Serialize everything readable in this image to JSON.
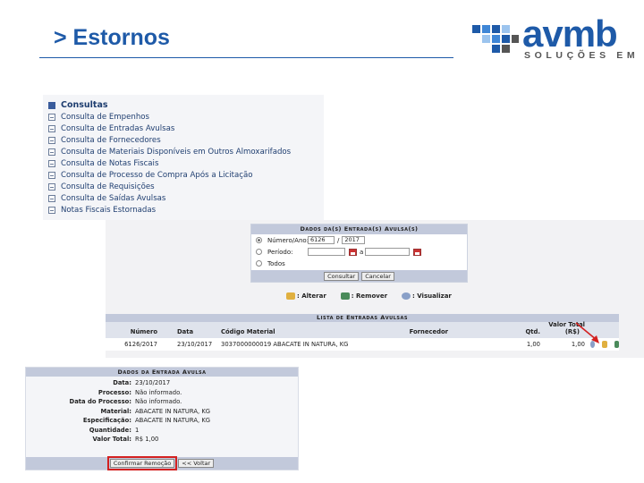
{
  "slide": {
    "title": "> Estornos"
  },
  "logo": {
    "brand": "avmb",
    "tagline": "SOLUÇÕES EM TI"
  },
  "menu": {
    "header": "Consultas",
    "items": [
      "Consulta de Empenhos",
      "Consulta de Entradas Avulsas",
      "Consulta de Fornecedores",
      "Consulta de Materiais Disponíveis em Outros Almoxarifados",
      "Consulta de Notas Fiscais",
      "Consulta de Processo de Compra Após a Licitação",
      "Consulta de Requisições",
      "Consulta de Saídas Avulsas",
      "Notas Fiscais Estornadas"
    ]
  },
  "search": {
    "caption": "Dados da(s) Entrada(s) Avulsa(s)",
    "numero_label": "Número/Ano:",
    "numero_value": "6126",
    "ano_value": "2017",
    "sep": "/",
    "periodo_label": "Período:",
    "periodo_sep": "a",
    "todos_label": "Todos",
    "consultar": "Consultar",
    "cancelar": "Cancelar"
  },
  "legend": {
    "alterar": ": Alterar",
    "remover": ": Remover",
    "visualizar": ": Visualizar"
  },
  "list": {
    "caption": "Lista de Entradas Avulsas",
    "headers": {
      "numero": "Número",
      "data": "Data",
      "codigo": "Código Material",
      "fornecedor": "Fornecedor",
      "qtd": "Qtd.",
      "valor_total": "Valor Total",
      "valor_unit": "(R$)"
    },
    "row": {
      "numero": "6126/2017",
      "data": "23/10/2017",
      "codigo": "3037000000019 ABACATE IN NATURA, KG",
      "fornecedor": "",
      "qtd": "1,00",
      "valor": "1,00"
    }
  },
  "detail": {
    "caption": "Dados da Entrada Avulsa",
    "fields": [
      {
        "k": "Data:",
        "v": "23/10/2017"
      },
      {
        "k": "Processo:",
        "v": "Não informado."
      },
      {
        "k": "Data do Processo:",
        "v": "Não informado."
      },
      {
        "k": "Material:",
        "v": "ABACATE IN NATURA, KG"
      },
      {
        "k": "Especificação:",
        "v": "ABACATE IN NATURA, KG"
      },
      {
        "k": "Quantidade:",
        "v": "1"
      },
      {
        "k": "Valor Total:",
        "v": "R$ 1,00"
      }
    ],
    "confirmar": "Confirmar Remoção",
    "voltar": "<< Voltar"
  },
  "colors": {
    "accent": "#1e5aa8",
    "highlight": "#d32020"
  }
}
